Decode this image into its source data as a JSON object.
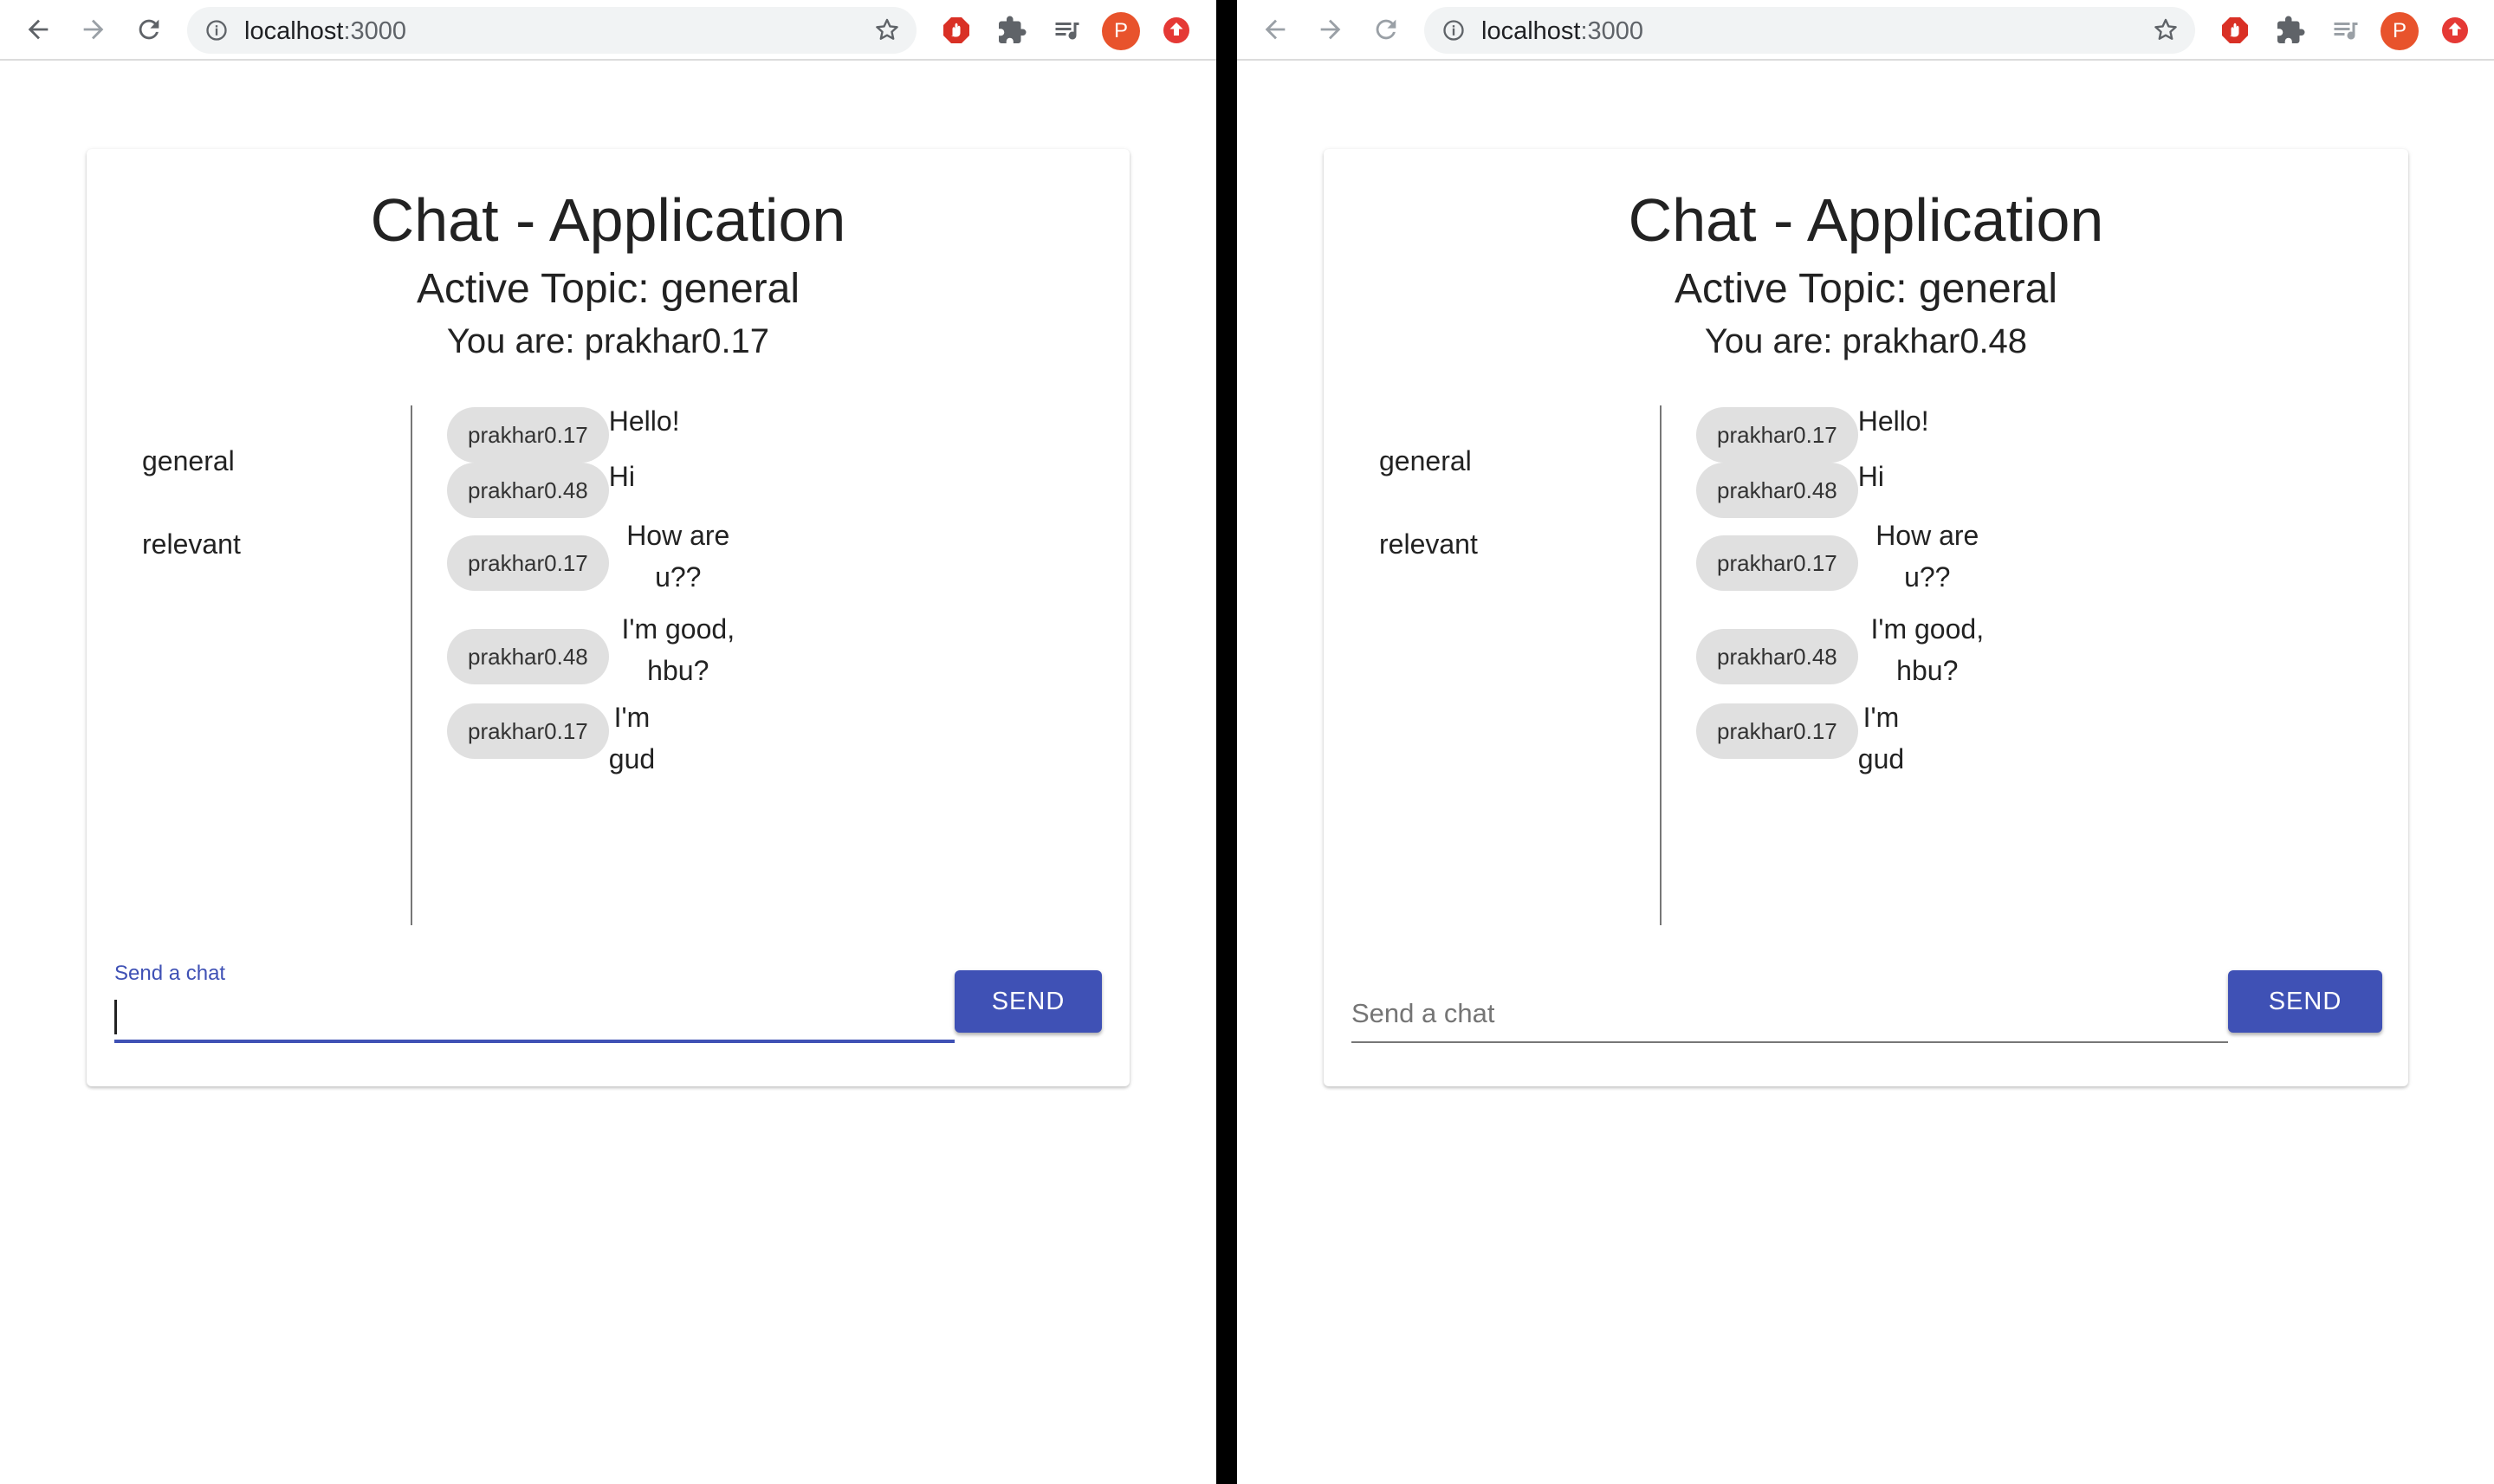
{
  "browser": {
    "url_host": "localhost",
    "url_port": ":3000",
    "avatar_letter": "P",
    "icons": [
      "back-icon",
      "forward-icon",
      "reload-icon",
      "info-icon",
      "star-icon",
      "adblock-icon",
      "extensions-puzzle-icon",
      "reading-list-icon",
      "upload-icon"
    ],
    "colors": {
      "adblock": "#d93025",
      "avatar": "#e8532c",
      "upload": "#e53935"
    }
  },
  "app": {
    "title": "Chat - Application",
    "active_topic": "Active Topic: general",
    "accent_color": "#3f51b5",
    "topics": [
      "general",
      "relevant"
    ],
    "messages": [
      {
        "from": "prakhar0.17",
        "text": "Hello!"
      },
      {
        "from": "prakhar0.48",
        "text": "Hi"
      },
      {
        "from": "prakhar0.17",
        "text": "How are u??"
      },
      {
        "from": "prakhar0.48",
        "text": "I'm good, hbu?"
      },
      {
        "from": "prakhar0.17",
        "text": "I'm gud"
      }
    ],
    "send_label": "SEND"
  },
  "left": {
    "you_are": "You are: prakhar0.17",
    "input_label": "Send a chat",
    "input_value": "",
    "input_focused": true
  },
  "right": {
    "you_are": "You are: prakhar0.48",
    "input_placeholder": "Send a chat",
    "input_value": "",
    "input_focused": false
  }
}
